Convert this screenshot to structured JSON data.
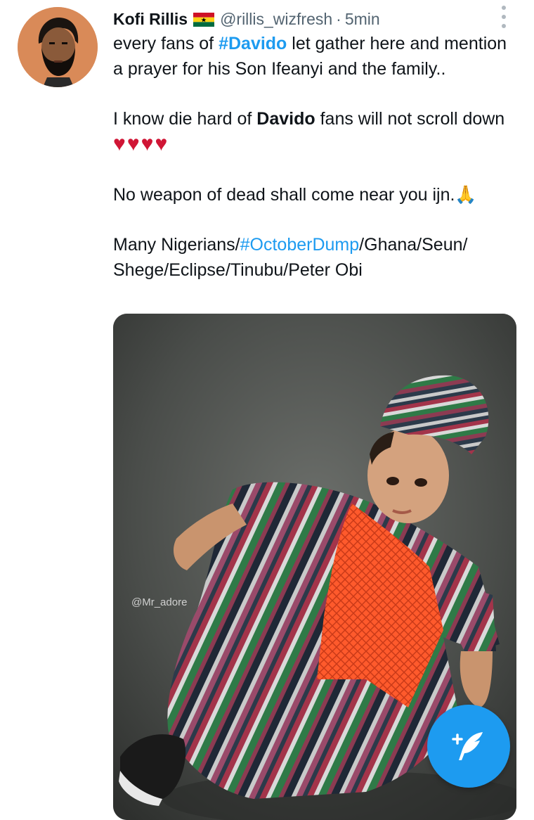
{
  "tweet": {
    "display_name": "Kofi Rillis",
    "flag_icon": "ghana-flag-icon",
    "handle": "@rillis_wizfresh",
    "separator": "·",
    "time": "5min",
    "line1_pre": "every fans of ",
    "line1_tag": "#Davido",
    "line1_post": " let gather here and mention a prayer for his Son Ifeanyi and the family..",
    "line2_pre": "I know die hard of ",
    "line2_bold": "Davido",
    "line2_post": " fans will not scroll down ",
    "hearts": "♥♥♥♥",
    "line3": "No weapon of dead shall come near you ijn.",
    "pray_emoji": "🙏",
    "line4_pre": "Many Nigerians/",
    "line4_tag": "#OctoberDump",
    "line4_post": "/Ghana/Seun/ Shege/Eclipse/Tinubu/Peter Obi"
  },
  "media": {
    "watermark": "@Mr_adore"
  },
  "colors": {
    "link": "#1d9bf0",
    "heart": "#d01535",
    "fab": "#1d9bf0",
    "avatar_bg": "#d98a58"
  },
  "fab": {
    "icon": "compose-tweet-icon"
  }
}
